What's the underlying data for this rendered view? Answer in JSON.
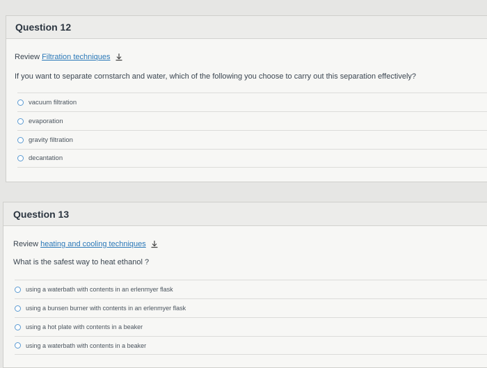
{
  "q12": {
    "title": "Question 12",
    "review_prefix": "Review",
    "review_link": "Filtration techniques",
    "prompt": "If you want to separate  cornstarch and water, which of the following you choose  to carry  out this separation effectively?",
    "options": [
      "vacuum filtration",
      "evaporation",
      "gravity filtration",
      "decantation"
    ]
  },
  "q13": {
    "title": "Question 13",
    "review_prefix": "Review",
    "review_link": "heating and cooling techniques",
    "prompt": "What is the safest way to heat ethanol ?",
    "options": [
      "using a waterbath with contents in an erlenmyer flask",
      "using a bunsen burner with contents in an erlenmyer flask",
      "using a hot plate with contents in a beaker",
      "using a waterbath with contents in a beaker"
    ]
  },
  "colors": {
    "link": "#2a78b8",
    "radio": "#5a9ad2"
  }
}
